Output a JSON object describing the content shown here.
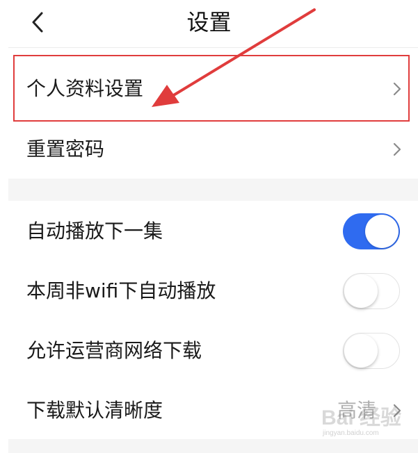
{
  "header": {
    "title": "设置",
    "back_icon": "chevron-left-icon"
  },
  "account_section": {
    "items": [
      {
        "label": "个人资料设置",
        "icon": "chevron-right-icon"
      },
      {
        "label": "重置密码",
        "icon": "chevron-right-icon"
      }
    ]
  },
  "playback_section": {
    "toggles": [
      {
        "label": "自动播放下一集",
        "on": true
      },
      {
        "label": "本周非wifi下自动播放",
        "on": false
      },
      {
        "label": "允许运营商网络下载",
        "on": false
      }
    ],
    "quality": {
      "label": "下载默认清晰度",
      "value": "高清",
      "icon": "chevron-right-icon"
    }
  },
  "colors": {
    "toggle_on": "#2f6bf0",
    "annotation": "#e03c3c",
    "section_gap": "#f5f5f5"
  },
  "watermark": {
    "brand": "Bai 经验",
    "url": "jingyan.baidu.com"
  }
}
